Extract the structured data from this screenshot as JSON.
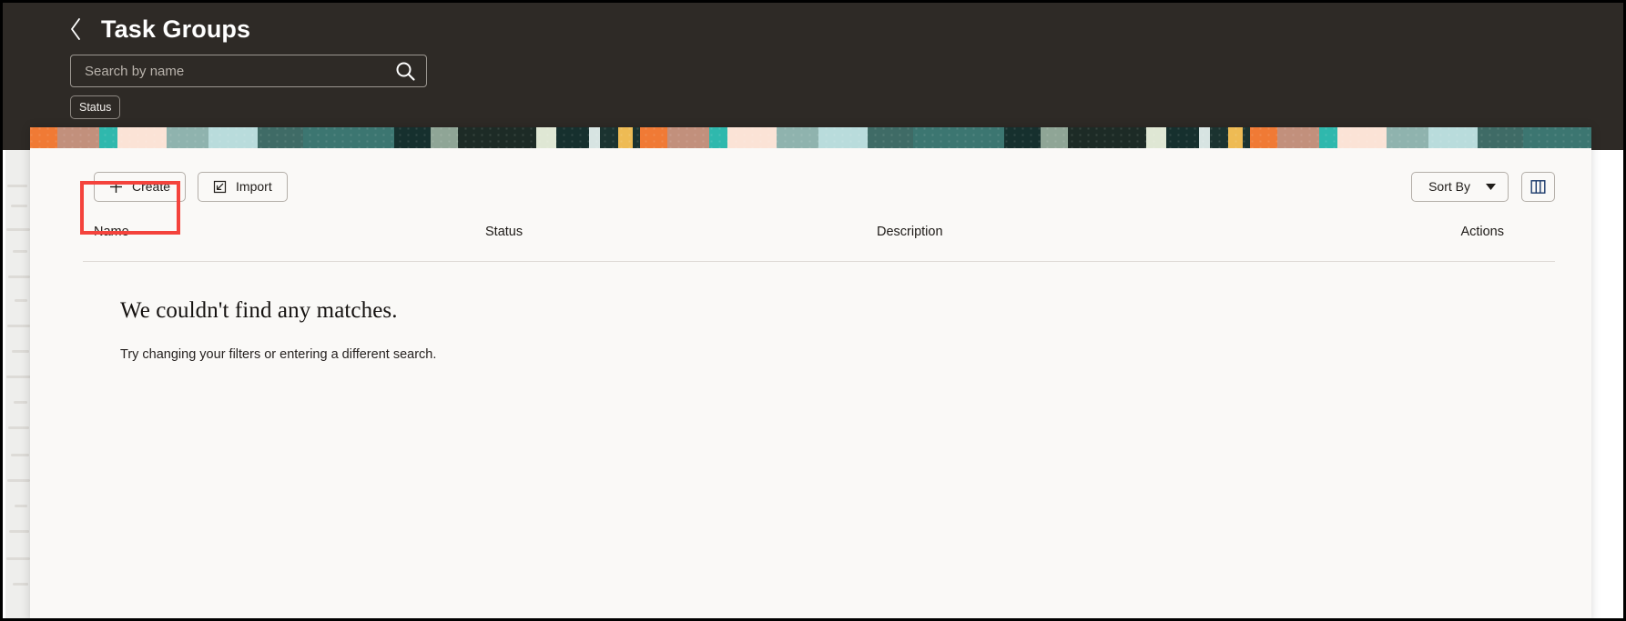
{
  "header": {
    "title": "Task Groups",
    "back_icon": "chevron-left-icon",
    "search": {
      "placeholder": "Search by name",
      "value": "",
      "icon": "search-icon"
    },
    "filters": [
      {
        "label": "Status"
      }
    ]
  },
  "toolbar": {
    "create_label": "Create",
    "create_icon": "plus-icon",
    "import_label": "Import",
    "import_icon": "import-arrow-icon",
    "sort_by_label": "Sort By",
    "sort_by_icon": "chevron-down-icon",
    "columns_toggle_icon": "column-layout-icon"
  },
  "table": {
    "columns": [
      "Name",
      "Status",
      "Description",
      "Actions"
    ]
  },
  "empty_state": {
    "title": "We couldn't find any matches.",
    "subtitle": "Try changing your filters or entering a different search."
  },
  "annotation": {
    "target": "Create",
    "color": "#f4433c"
  },
  "colors": {
    "header_bg": "#2e2a26",
    "panel_bg": "#faf9f7",
    "highlight": "#f4433c",
    "banner_teal": "#3c7671",
    "banner_orange": "#f07a35",
    "banner_cream": "#fbe3d6",
    "banner_dark": "#16302e",
    "banner_yellow": "#eebb54"
  }
}
